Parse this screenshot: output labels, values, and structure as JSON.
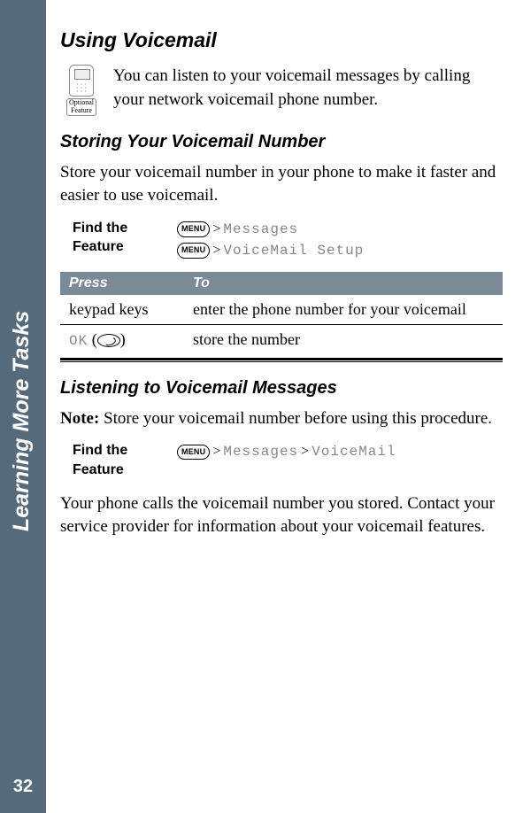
{
  "sidebar": {
    "title": "Learning More Tasks",
    "page_number": "32"
  },
  "h1": "Using Voicemail",
  "intro": "You can listen to your voicemail messages by calling your network voicemail phone number.",
  "optional_label_line1": "Optional",
  "optional_label_line2": "Feature",
  "h2_store": "Storing Your Voicemail Number",
  "store_para": "Store your voicemail number in your phone to make it faster and easier to use voicemail.",
  "find_label": "Find the Feature",
  "menu_btn": "MENU",
  "gt": ">",
  "path_messages": "Messages",
  "path_vm_setup": "VoiceMail Setup",
  "table": {
    "head_press": "Press",
    "head_to": "To",
    "rows": [
      {
        "press": "keypad keys",
        "to": "enter the phone number for your voicemail"
      },
      {
        "press_code": "OK",
        "press_paren_open": "(",
        "press_paren_close": ")",
        "to": "store the number"
      }
    ]
  },
  "h2_listen": "Listening to Voicemail Messages",
  "note_label": "Note:",
  "note_text": " Store your voicemail number before using this procedure.",
  "path_voicemail": "VoiceMail",
  "closing": "Your phone calls the voicemail number you stored. Contact your service provider for information about your voicemail features."
}
